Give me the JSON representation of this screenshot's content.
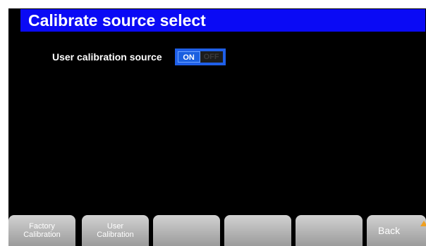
{
  "header": {
    "title": "Calibrate source select"
  },
  "setting": {
    "label": "User calibration source",
    "toggle": {
      "on_label": "ON",
      "off_label": "OFF",
      "selected": "ON"
    }
  },
  "softkeys": {
    "factory": {
      "line1": "Factory",
      "line2": "Calibration"
    },
    "user": {
      "line1": "User",
      "line2": "Calibration"
    },
    "back": {
      "label": "Back"
    }
  },
  "colors": {
    "title_bar": "#0a0af5",
    "toggle_on": "#1a5fe0",
    "screen_bg": "#000000",
    "back_arrow": "#f0a020"
  },
  "icons": {
    "back": "up-arrow-icon"
  }
}
